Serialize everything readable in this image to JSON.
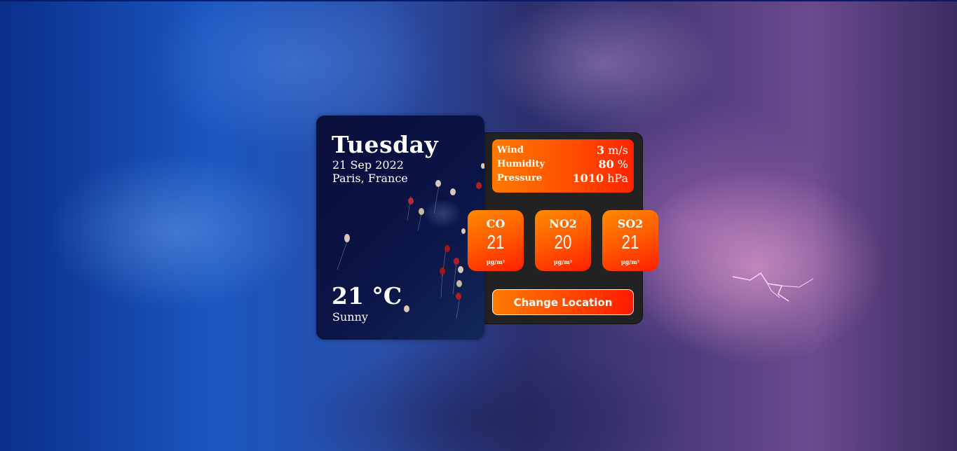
{
  "weather": {
    "day": "Tuesday",
    "date": "21 Sep 2022",
    "location": "Paris, France",
    "temperature": "21 °C",
    "condition": "Sunny"
  },
  "stats": [
    {
      "label": "Wind",
      "value": "3",
      "unit": "m/s"
    },
    {
      "label": "Humidity",
      "value": "80",
      "unit": "%"
    },
    {
      "label": "Pressure",
      "value": "1010",
      "unit": "hPa"
    }
  ],
  "air_quality": [
    {
      "name": "CO",
      "value": "21",
      "unit": "μg/m³"
    },
    {
      "name": "NO2",
      "value": "20",
      "unit": "μg/m³"
    },
    {
      "name": "SO2",
      "value": "21",
      "unit": "μg/m³"
    }
  ],
  "actions": {
    "change_location_label": "Change Location"
  },
  "colors": {
    "accent_start": "#ff7a00",
    "accent_end": "#ff2200",
    "panel": "#222222",
    "card": "#0b1547"
  }
}
